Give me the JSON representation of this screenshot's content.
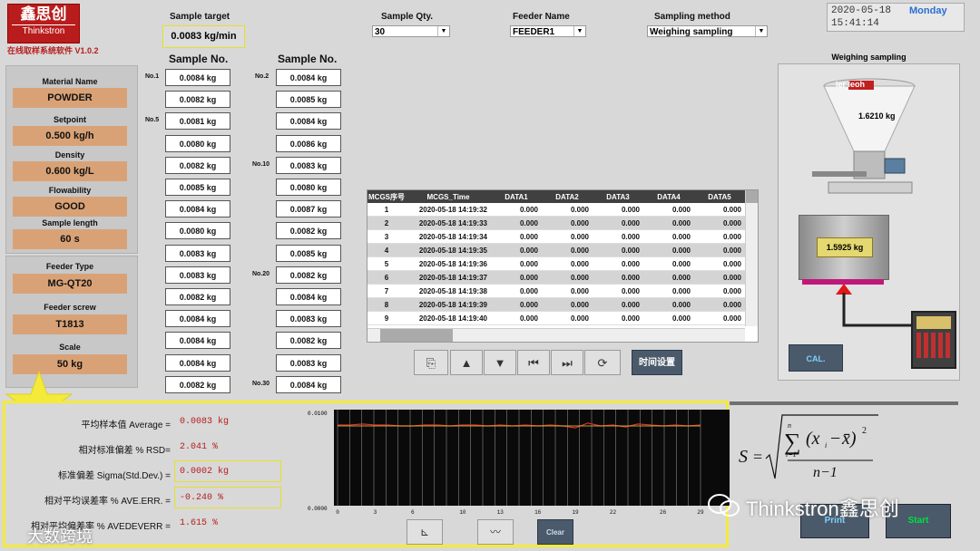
{
  "brand": {
    "logo_cn": "鑫思创",
    "logo_en": "Thinkstron",
    "version": "在线取样系统软件 V1.0.2"
  },
  "header": {
    "sample_target_label": "Sample target",
    "sample_target_value": "0.0083 kg/min",
    "sample_qty_label": "Sample Qty.",
    "sample_qty_value": "30",
    "feeder_name_label": "Feeder Name",
    "feeder_name_value": "FEEDER1",
    "sampling_method_label": "Sampling method",
    "sampling_method_value": "Weighing sampling",
    "date": "2020-05-18",
    "weekday": "Monday",
    "time": "15:41:14"
  },
  "material_panel": [
    {
      "label": "Material Name",
      "value": "POWDER"
    },
    {
      "label": "Setpoint",
      "value": "0.500 kg/h"
    },
    {
      "label": "Density",
      "value": "0.600 kg/L"
    },
    {
      "label": "Flowability",
      "value": "GOOD"
    },
    {
      "label": "Sample length",
      "value": "60 s"
    }
  ],
  "feeder_panel": [
    {
      "label": "Feeder Type",
      "value": "MG-QT20"
    },
    {
      "label": "Feeder screw",
      "value": "T1813"
    },
    {
      "label": "Scale",
      "value": "50 kg"
    }
  ],
  "samples": {
    "header": "Sample No.",
    "col1": [
      "0.0084 kg",
      "0.0082 kg",
      "0.0081 kg",
      "0.0080 kg",
      "0.0082 kg",
      "0.0085 kg",
      "0.0084 kg",
      "0.0080 kg",
      "0.0083 kg",
      "0.0083 kg",
      "0.0082 kg",
      "0.0084 kg",
      "0.0084 kg",
      "0.0084 kg",
      "0.0082 kg"
    ],
    "col2": [
      "0.0084 kg",
      "0.0085 kg",
      "0.0084 kg",
      "0.0086 kg",
      "0.0083 kg",
      "0.0080 kg",
      "0.0087 kg",
      "0.0082 kg",
      "0.0085 kg",
      "0.0082 kg",
      "0.0084 kg",
      "0.0083 kg",
      "0.0082 kg",
      "0.0083 kg",
      "0.0084 kg"
    ],
    "tags": {
      "no1": "No.1",
      "no2": "No.2",
      "no5": "No.5",
      "no10": "No.10",
      "no20": "No.20",
      "no30": "No.30"
    }
  },
  "log_table": {
    "columns": [
      "MCGS序号",
      "MCGS_Time",
      "DATA1",
      "DATA2",
      "DATA3",
      "DATA4",
      "DATA5"
    ],
    "rows": [
      [
        "1",
        "2020-05-18 14:19:32",
        "0.000",
        "0.000",
        "0.000",
        "0.000",
        "0.000"
      ],
      [
        "2",
        "2020-05-18 14:19:33",
        "0.000",
        "0.000",
        "0.000",
        "0.000",
        "0.000"
      ],
      [
        "3",
        "2020-05-18 14:19:34",
        "0.000",
        "0.000",
        "0.000",
        "0.000",
        "0.000"
      ],
      [
        "4",
        "2020-05-18 14:19:35",
        "0.000",
        "0.000",
        "0.000",
        "0.000",
        "0.000"
      ],
      [
        "5",
        "2020-05-18 14:19:36",
        "0.000",
        "0.000",
        "0.000",
        "0.000",
        "0.000"
      ],
      [
        "6",
        "2020-05-18 14:19:37",
        "0.000",
        "0.000",
        "0.000",
        "0.000",
        "0.000"
      ],
      [
        "7",
        "2020-05-18 14:19:38",
        "0.000",
        "0.000",
        "0.000",
        "0.000",
        "0.000"
      ],
      [
        "8",
        "2020-05-18 14:19:39",
        "0.000",
        "0.000",
        "0.000",
        "0.000",
        "0.000"
      ],
      [
        "9",
        "2020-05-18 14:19:40",
        "0.000",
        "0.000",
        "0.000",
        "0.000",
        "0.000"
      ]
    ],
    "time_setting_label": "时间设置"
  },
  "weighing": {
    "title": "Weighing sampling",
    "hopper_brand": "ler leoh",
    "hopper_weight": "1.6210 kg",
    "scale_weight": "1.5925 kg",
    "cal_label": "CAL."
  },
  "stats": [
    {
      "label": "平均样本值 Average =",
      "value": "0.0083 kg"
    },
    {
      "label": "相对标准偏差 % RSD=",
      "value": "2.041 %"
    },
    {
      "label": "标准偏差 Sigma(Std.Dev.) =",
      "value": "0.0002 kg"
    },
    {
      "label": "相对平均误差率 % AVE.ERR. =",
      "value": "-0.240 %"
    },
    {
      "label": "相对平均偏差率 % AVEDEVERR =",
      "value": "1.615 %"
    }
  ],
  "trend": {
    "y_max_label": "0.0100",
    "y_min_label": "0.0000",
    "x_ticks": [
      "0",
      "3",
      "6",
      "10",
      "13",
      "16",
      "19",
      "22",
      "26",
      "29"
    ],
    "values": [
      0.0084,
      0.0084,
      0.0085,
      0.0084,
      0.0084,
      0.0083,
      0.0083,
      0.0084,
      0.0084,
      0.0083,
      0.0084,
      0.0084,
      0.0083,
      0.0084,
      0.0083,
      0.0084,
      0.0083,
      0.0084,
      0.0083,
      0.0081,
      0.0086,
      0.0083,
      0.0084,
      0.0082,
      0.0085,
      0.0084,
      0.0083,
      0.0084,
      0.0083,
      0.0084
    ],
    "clear_label": "Clear"
  },
  "actions": {
    "print_label": "Print",
    "start_label": "Start"
  },
  "watermark": {
    "wechat": "Thinkstron鑫思创",
    "corner": "大数跨境"
  }
}
